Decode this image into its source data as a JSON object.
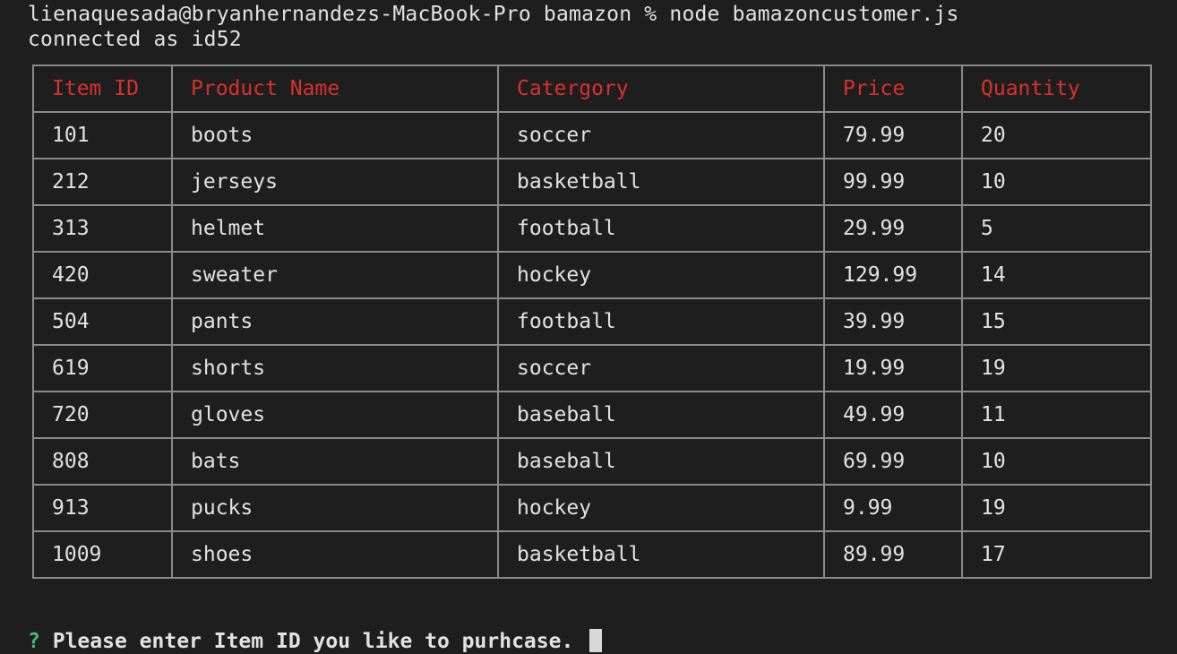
{
  "terminal": {
    "command_line": "lienaquesada@bryanhernandezs-MacBook-Pro bamazon % node bamazoncustomer.js",
    "connection_line": "connected as id52",
    "colors": {
      "background": "#1e1e1e",
      "text": "#e2e2e2",
      "header_text": "#d9302c",
      "prompt_mark": "#3fbf6f",
      "table_border": "#8a8a8a"
    }
  },
  "table": {
    "headers": [
      "Item ID",
      "Product Name",
      "Catergory",
      "Price",
      "Quantity"
    ],
    "rows": [
      [
        "101",
        "boots",
        "soccer",
        "79.99",
        "20"
      ],
      [
        "212",
        "jerseys",
        "basketball",
        "99.99",
        "10"
      ],
      [
        "313",
        "helmet",
        "football",
        "29.99",
        "5"
      ],
      [
        "420",
        "sweater",
        "hockey",
        "129.99",
        "14"
      ],
      [
        "504",
        "pants",
        "football",
        "39.99",
        "15"
      ],
      [
        "619",
        "shorts",
        "soccer",
        "19.99",
        "19"
      ],
      [
        "720",
        "gloves",
        "baseball",
        "49.99",
        "11"
      ],
      [
        "808",
        "bats",
        "baseball",
        "69.99",
        "10"
      ],
      [
        "913",
        "pucks",
        "hockey",
        "9.99",
        "19"
      ],
      [
        "1009",
        "shoes",
        "basketball",
        "89.99",
        "17"
      ]
    ]
  },
  "prompt": {
    "mark": "?",
    "question": "Please enter Item ID you like to purhcase."
  }
}
